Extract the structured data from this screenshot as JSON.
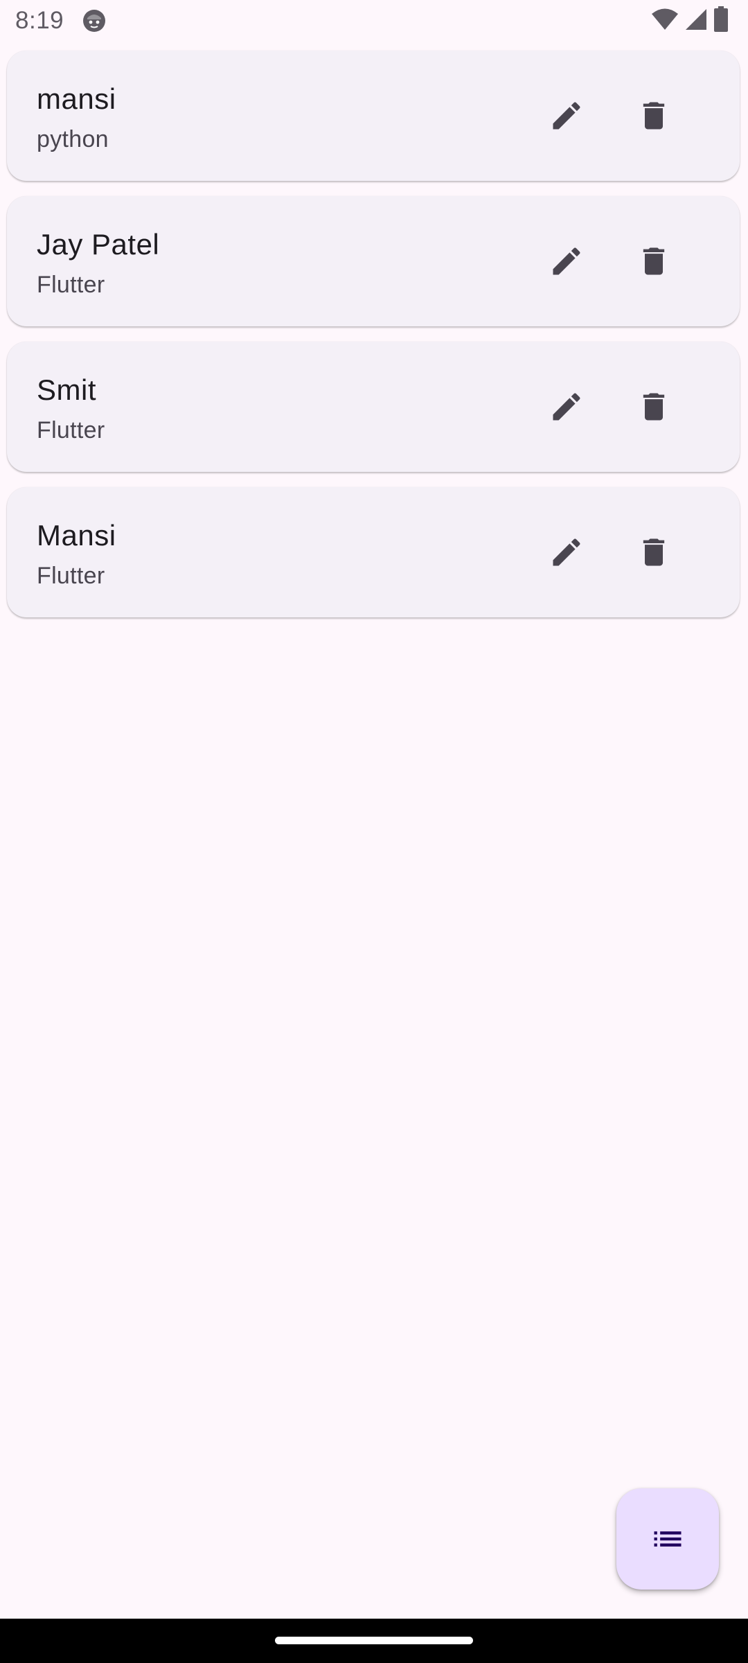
{
  "status_bar": {
    "time": "8:19",
    "icons": [
      "app-notification-icon",
      "wifi-icon",
      "cellular-signal-icon",
      "battery-icon"
    ],
    "icon_color": "#5f5b63"
  },
  "items": [
    {
      "title": "mansi",
      "subtitle": "python"
    },
    {
      "title": "Jay Patel",
      "subtitle": "Flutter"
    },
    {
      "title": "Smit",
      "subtitle": "Flutter"
    },
    {
      "title": "Mansi",
      "subtitle": "Flutter"
    }
  ],
  "item_actions": {
    "edit_icon": "pencil-edit-icon",
    "delete_icon": "trash-delete-icon",
    "icon_color": "#49454f"
  },
  "fab": {
    "icon": "list-icon",
    "background": "#EADDFF",
    "icon_color": "#21005D"
  },
  "colors": {
    "background": "#FEF7FC",
    "card_background": "#F4F0F7"
  }
}
